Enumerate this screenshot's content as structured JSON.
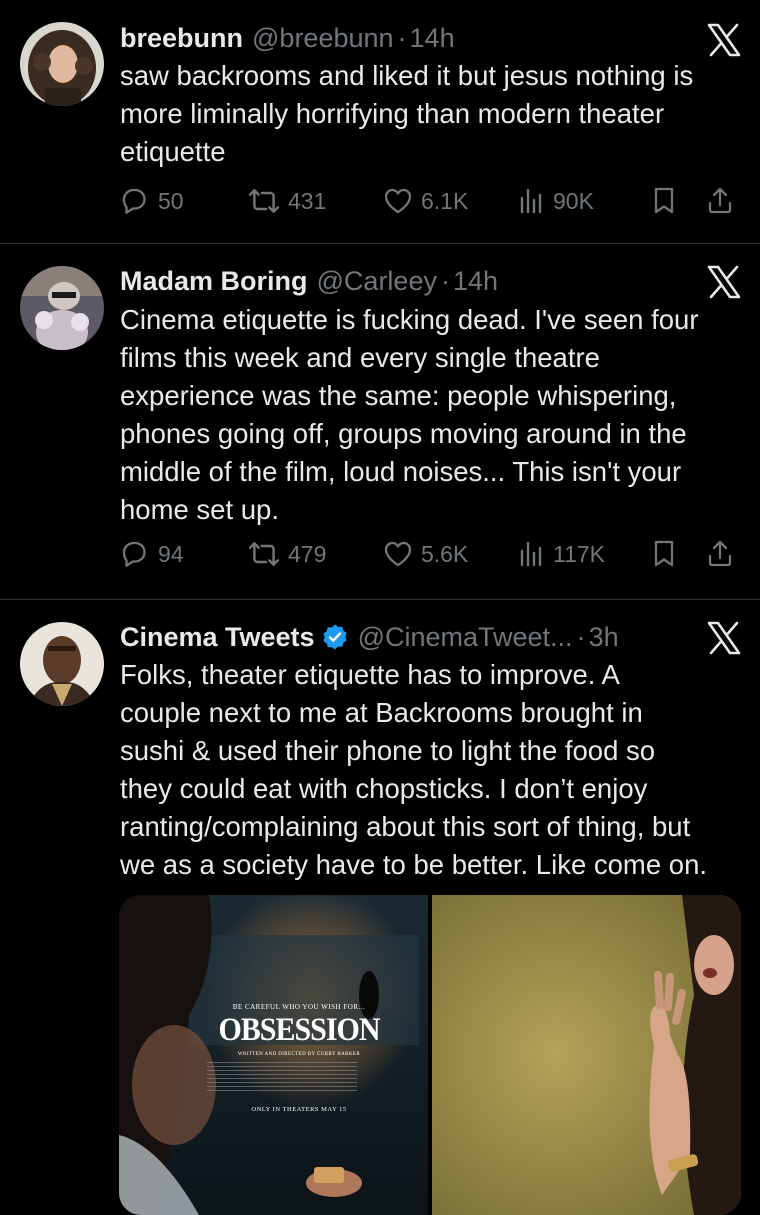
{
  "tweets": [
    {
      "name": "breebunn",
      "handle": "@breebunn",
      "sep": "·",
      "time": "14h",
      "lines": [
        "saw backrooms and liked it but jesus nothing is",
        "more liminally horrifying than modern theater",
        "etiquette"
      ],
      "replies": "50",
      "reposts": "431",
      "likes": "6.1K",
      "views": "90K"
    },
    {
      "name": "Madam Boring",
      "handle": "@Carleey",
      "sep": "·",
      "time": "14h",
      "lines": [
        "Cinema etiquette is fucking dead. I've seen four",
        "films this week and every single theatre",
        "experience was the same: people whispering,",
        "phones going off, groups moving around in the",
        "middle of the film, loud noises... This isn't your",
        "home set up."
      ],
      "replies": "94",
      "reposts": "479",
      "likes": "5.6K",
      "views": "117K"
    },
    {
      "name": "Cinema Tweets",
      "handle": "@CinemaTweet...",
      "sep": "·",
      "time": "3h",
      "lines": [
        "Folks, theater etiquette has to improve. A",
        "couple next to me at Backrooms brought in",
        "sushi & used their phone to light the food so",
        "they could eat with chopsticks. I don’t enjoy",
        "ranting/complaining about this sort of thing, but",
        "we as a society have to be better. Like come on."
      ],
      "poster": {
        "tagline": "BE CAREFUL WHO YOU WISH FOR...",
        "title": "OBSESSION",
        "credit": "WRITTEN AND DIRECTED BY CURRY BARKER",
        "release": "ONLY IN THEATERS MAY 15"
      }
    }
  ],
  "colors": {
    "background": "#000000",
    "text": "#e7e9ea",
    "muted": "#71767b",
    "divider": "#2f3336",
    "verified": "#1d9bf0"
  },
  "icons": [
    "x-logo-icon",
    "reply-icon",
    "repost-icon",
    "like-icon",
    "views-icon",
    "bookmark-icon",
    "share-icon",
    "verified-badge-icon"
  ]
}
